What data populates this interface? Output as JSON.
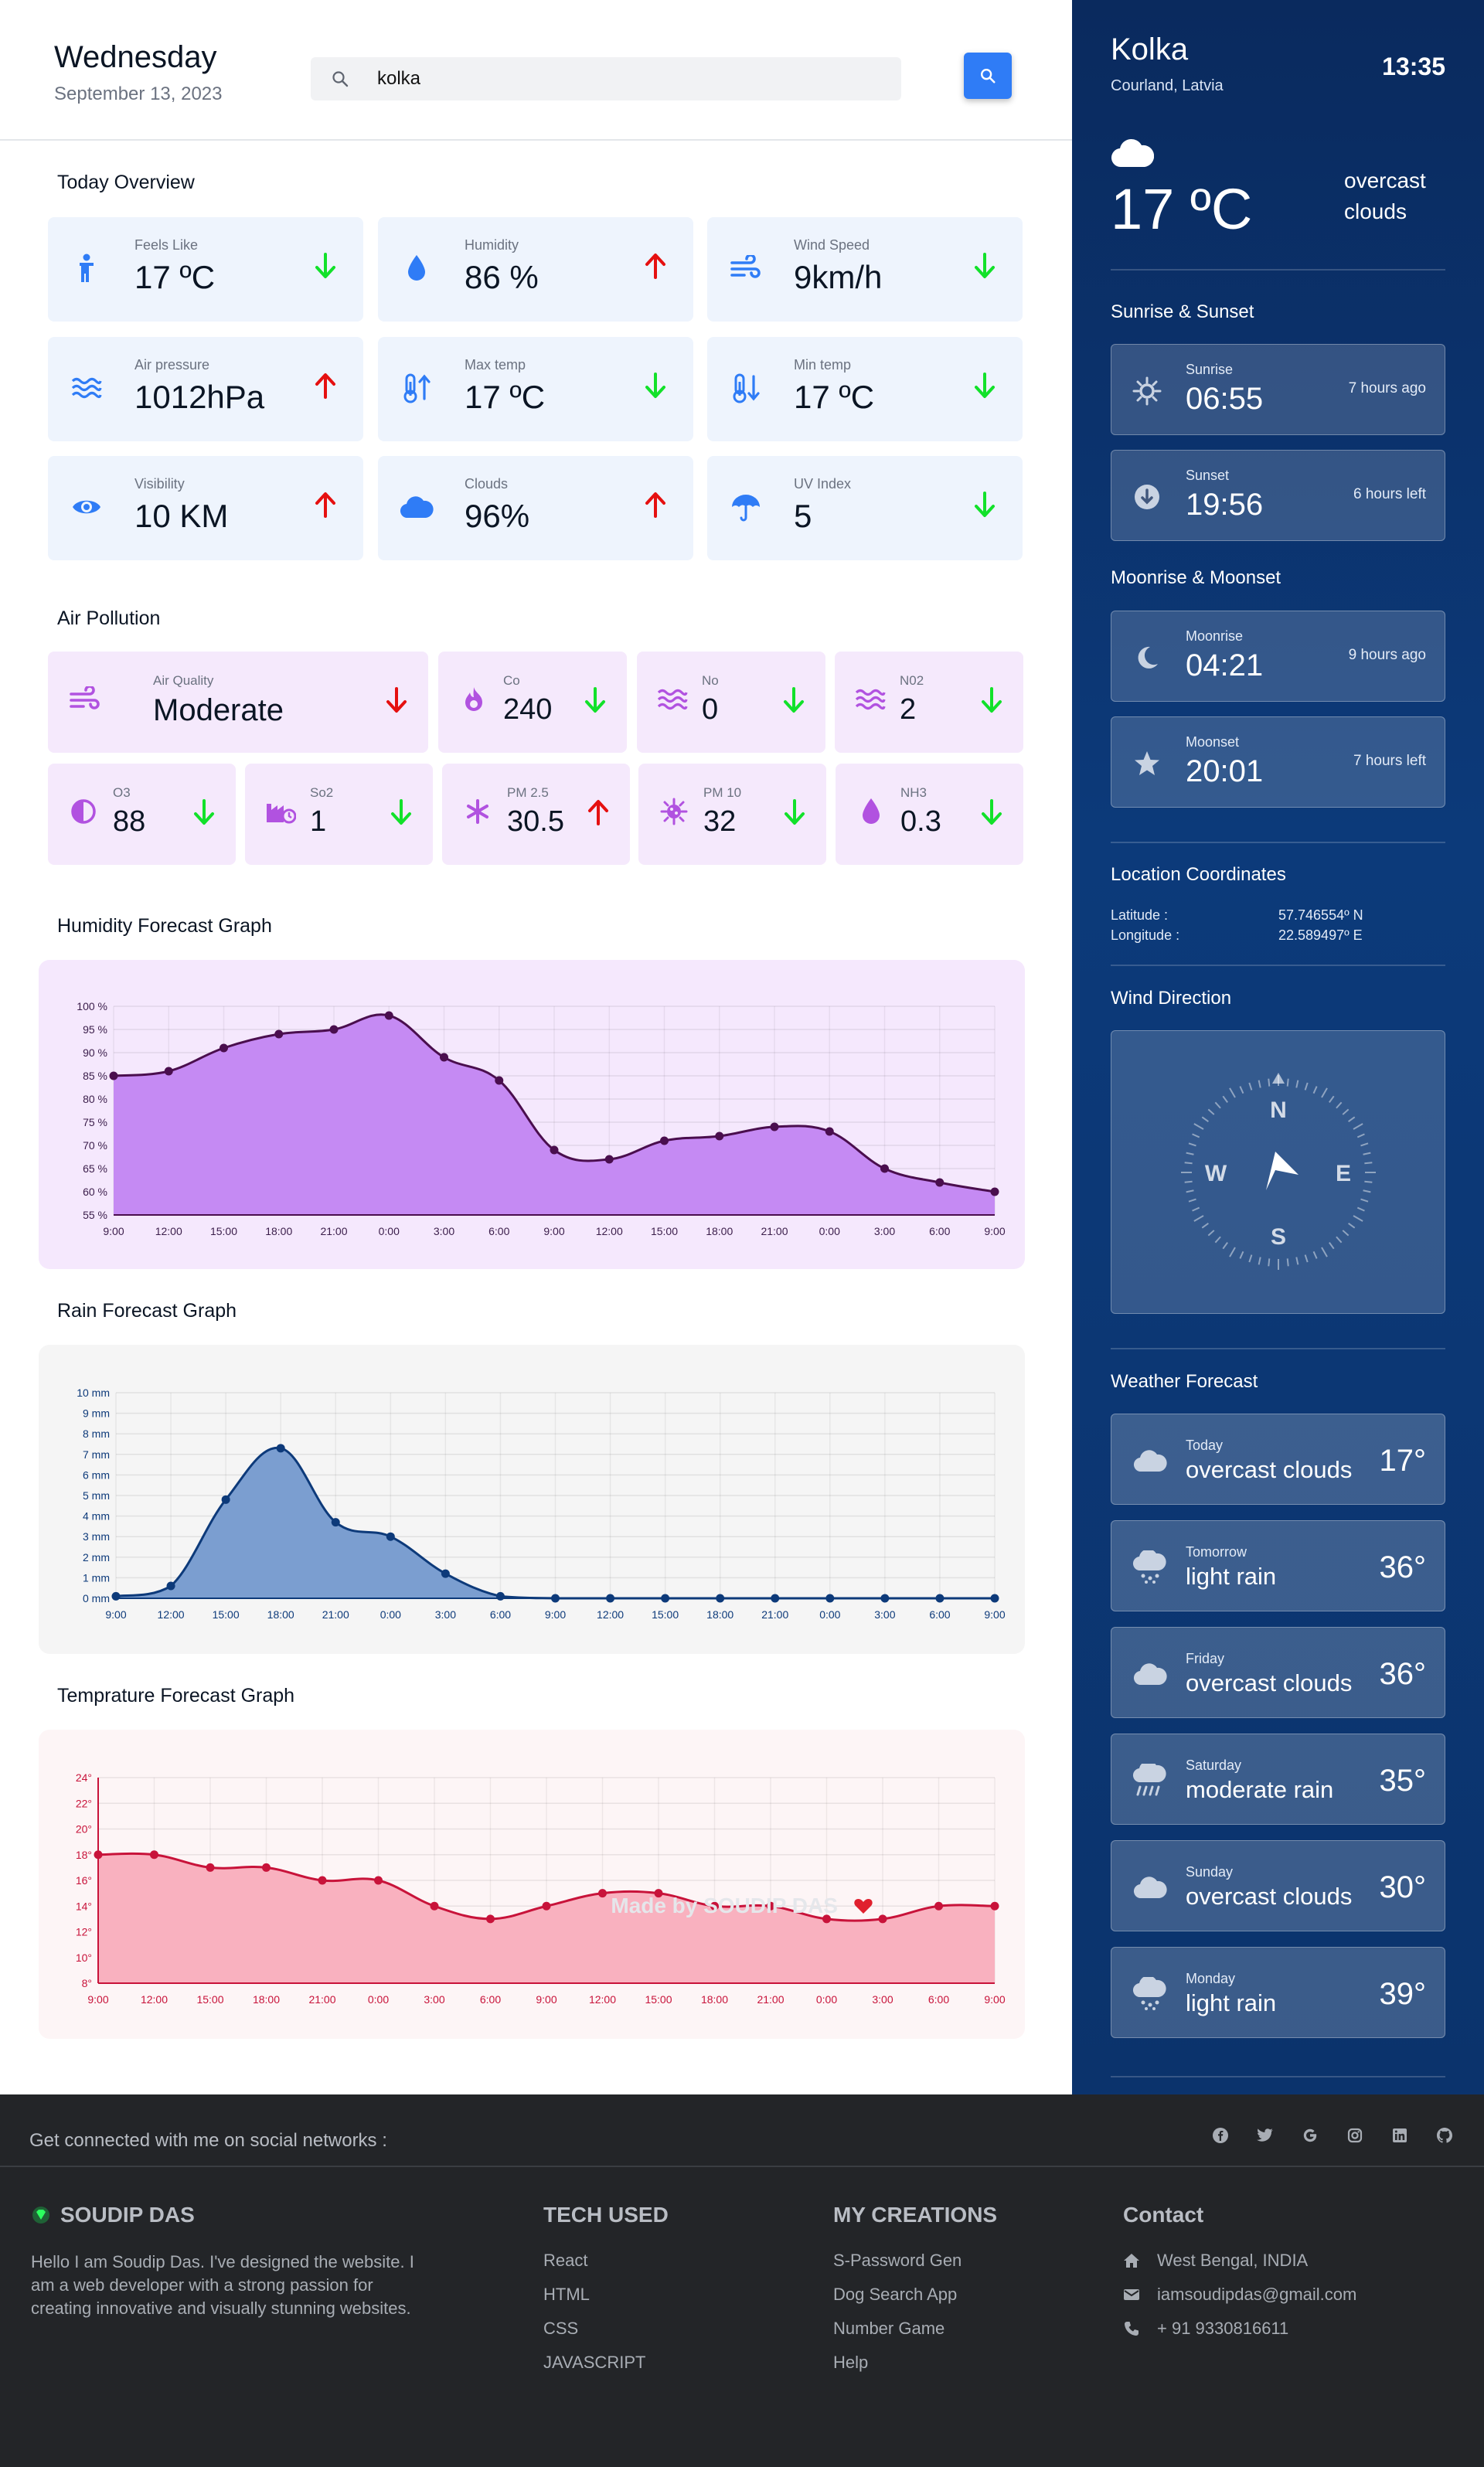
{
  "header": {
    "day": "Wednesday",
    "date": "September 13, 2023",
    "search_value": "kolka"
  },
  "overview": {
    "title": "Today Overview",
    "cards": [
      {
        "label": "Feels Like",
        "value": "17 ºC",
        "icon": "person-icon",
        "trend": "down"
      },
      {
        "label": "Humidity",
        "value": "86 %",
        "icon": "droplet-icon",
        "trend": "up"
      },
      {
        "label": "Wind Speed",
        "value": "9km/h",
        "icon": "wind-icon",
        "trend": "down"
      },
      {
        "label": "Air pressure",
        "value": "1012hPa",
        "icon": "waves-icon",
        "trend": "up"
      },
      {
        "label": "Max temp",
        "value": "17 ºC",
        "icon": "thermometer-up-icon",
        "trend": "down"
      },
      {
        "label": "Min temp",
        "value": "17 ºC",
        "icon": "thermometer-down-icon",
        "trend": "down"
      },
      {
        "label": "Visibility",
        "value": "10 KM",
        "icon": "eye-icon",
        "trend": "up"
      },
      {
        "label": "Clouds",
        "value": "96%",
        "icon": "cloud-icon",
        "trend": "up"
      },
      {
        "label": "UV Index",
        "value": "5",
        "icon": "umbrella-icon",
        "trend": "down"
      }
    ]
  },
  "pollution": {
    "title": "Air Pollution",
    "row1": [
      {
        "label": "Air Quality",
        "value": "Moderate",
        "icon": "wind-icon",
        "trend": "down-red"
      },
      {
        "label": "Co",
        "value": "240",
        "icon": "fire-icon",
        "trend": "down"
      },
      {
        "label": "No",
        "value": "0",
        "icon": "waves-icon",
        "trend": "down"
      },
      {
        "label": "N02",
        "value": "2",
        "icon": "waves-icon",
        "trend": "down"
      }
    ],
    "row2": [
      {
        "label": "O3",
        "value": "88",
        "icon": "half-circle-icon",
        "trend": "down"
      },
      {
        "label": "So2",
        "value": "1",
        "icon": "factory-icon",
        "trend": "down"
      },
      {
        "label": "PM 2.5",
        "value": "30.5",
        "icon": "asterisk-icon",
        "trend": "up"
      },
      {
        "label": "PM 10",
        "value": "32",
        "icon": "virus-icon",
        "trend": "down"
      },
      {
        "label": "NH3",
        "value": "0.3",
        "icon": "droplet-icon",
        "trend": "down"
      }
    ]
  },
  "colors": {
    "humidity_line": "#4a0e4e",
    "humidity_fill": "#c58af3",
    "rain_line": "#0d3a7a",
    "rain_fill": "#7b9ed0",
    "temp_line": "#c8133a",
    "temp_fill": "#f9b1bf",
    "trend_up": "#e51010",
    "trend_down": "#12e12a",
    "accent": "#2f7cf6"
  },
  "chart_data": [
    {
      "type": "area",
      "title": "Humidity Forecast Graph",
      "x": [
        "9:00",
        "12:00",
        "15:00",
        "18:00",
        "21:00",
        "0:00",
        "3:00",
        "6:00",
        "9:00",
        "12:00",
        "15:00",
        "18:00",
        "21:00",
        "0:00",
        "3:00",
        "6:00",
        "9:00"
      ],
      "values": [
        85,
        86,
        91,
        94,
        95,
        98,
        89,
        84,
        69,
        67,
        71,
        72,
        74,
        73,
        65,
        62,
        60
      ],
      "ylim": [
        55,
        100
      ],
      "yticks": [
        "55 %",
        "60 %",
        "65 %",
        "70 %",
        "75 %",
        "80 %",
        "85 %",
        "90 %",
        "95 %",
        "100 %"
      ],
      "grid": true
    },
    {
      "type": "area",
      "title": "Rain Forecast Graph",
      "x": [
        "9:00",
        "12:00",
        "15:00",
        "18:00",
        "21:00",
        "0:00",
        "3:00",
        "6:00",
        "9:00",
        "12:00",
        "15:00",
        "18:00",
        "21:00",
        "0:00",
        "3:00",
        "6:00",
        "9:00"
      ],
      "values": [
        0.1,
        0.6,
        4.8,
        7.3,
        3.7,
        3.0,
        1.2,
        0.1,
        0,
        0,
        0,
        0,
        0,
        0,
        0,
        0,
        0
      ],
      "ylim": [
        0,
        10
      ],
      "yticks": [
        "0 mm",
        "1 mm",
        "2 mm",
        "3 mm",
        "4 mm",
        "5 mm",
        "6 mm",
        "7 mm",
        "8 mm",
        "9 mm",
        "10 mm"
      ],
      "grid": true
    },
    {
      "type": "area",
      "title": "Temprature Forecast Graph",
      "x": [
        "9:00",
        "12:00",
        "15:00",
        "18:00",
        "21:00",
        "0:00",
        "3:00",
        "6:00",
        "9:00",
        "12:00",
        "15:00",
        "18:00",
        "21:00",
        "0:00",
        "3:00",
        "6:00",
        "9:00"
      ],
      "values": [
        18,
        18,
        17,
        17,
        16,
        16,
        14,
        13,
        14,
        15,
        15,
        14,
        14,
        13,
        13,
        14,
        14
      ],
      "ylim": [
        8,
        24
      ],
      "yticks": [
        "8°",
        "10°",
        "12°",
        "14°",
        "16°",
        "18°",
        "20°",
        "22°",
        "24°"
      ],
      "grid": true
    }
  ],
  "sidebar": {
    "city": "Kolka",
    "country": "Courland, Latvia",
    "time": "13:35",
    "temp": "17 ºC",
    "description": "overcast clouds",
    "sun_title": "Sunrise & Sunset",
    "sunrise": {
      "label": "Sunrise",
      "value": "06:55",
      "ago": "7 hours ago"
    },
    "sunset": {
      "label": "Sunset",
      "value": "19:56",
      "ago": "6 hours left"
    },
    "moon_title": "Moonrise & Moonset",
    "moonrise": {
      "label": "Moonrise",
      "value": "04:21",
      "ago": "9 hours ago"
    },
    "moonset": {
      "label": "Moonset",
      "value": "20:01",
      "ago": "7 hours left"
    },
    "coord_title": "Location Coordinates",
    "lat_label": "Latitude :",
    "lat_value": "57.746554º N",
    "lon_label": "Longitude :",
    "lon_value": "22.589497º E",
    "wind_title": "Wind Direction",
    "compass": {
      "n": "N",
      "e": "E",
      "s": "S",
      "w": "W"
    },
    "forecast_title": "Weather Forecast",
    "forecast": [
      {
        "day": "Today",
        "desc": "overcast clouds",
        "temp": "17°",
        "icon": "cloud-icon"
      },
      {
        "day": "Tomorrow",
        "desc": "light rain",
        "temp": "36°",
        "icon": "cloud-rain-icon"
      },
      {
        "day": "Friday",
        "desc": "overcast clouds",
        "temp": "36°",
        "icon": "cloud-icon"
      },
      {
        "day": "Saturday",
        "desc": "moderate rain",
        "temp": "35°",
        "icon": "cloud-showers-icon"
      },
      {
        "day": "Sunday",
        "desc": "overcast clouds",
        "temp": "30°",
        "icon": "cloud-icon"
      },
      {
        "day": "Monday",
        "desc": "light rain",
        "temp": "39°",
        "icon": "cloud-rain-icon"
      }
    ]
  },
  "footer": {
    "connect": "Get connected with me on social networks :",
    "brand": "SOUDIP DAS",
    "about": "Hello I am Soudip Das. I've designed the website. I am a web developer with a strong passion for creating innovative and visually stunning websites.",
    "tech_title": "TECH USED",
    "tech": [
      "React",
      "HTML",
      "CSS",
      "JAVASCRIPT"
    ],
    "creations_title": "MY CREATIONS",
    "creations": [
      "S-Password Gen",
      "Dog Search App",
      "Number Game",
      "Help"
    ],
    "contact_title": "Contact",
    "address": "West Bengal, INDIA",
    "email": "iamsoudipdas@gmail.com",
    "phone": "+ 91 9330816611",
    "made_by": "Made by SOUDIP DAS"
  }
}
